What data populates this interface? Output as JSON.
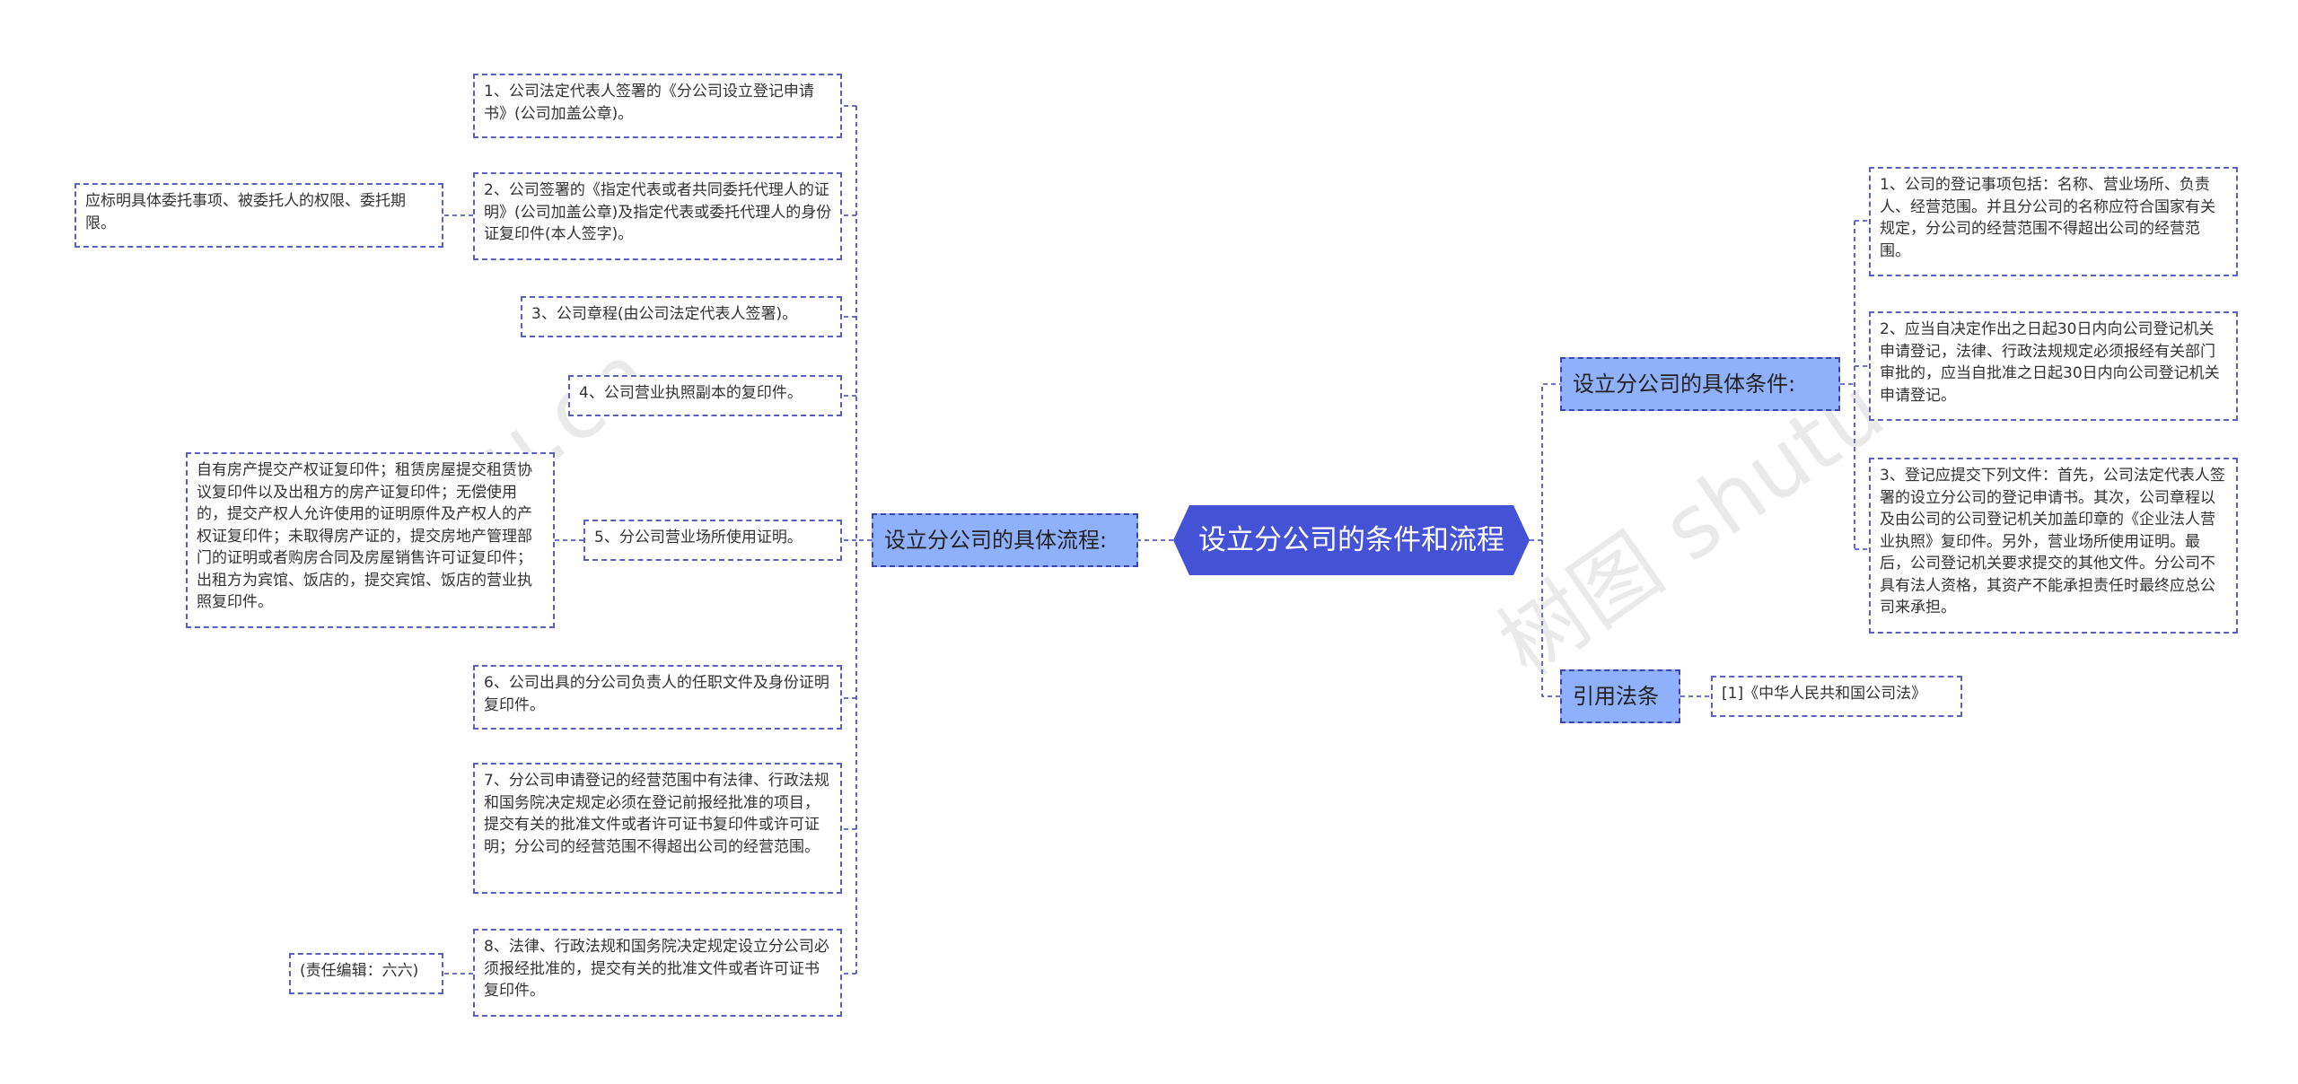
{
  "root": {
    "title": "设立分公司的条件和流程"
  },
  "left_branch": {
    "label": "设立分公司的具体流程:",
    "items": [
      {
        "text": "1、公司法定代表人签署的《分公司设立登记申请书》(公司加盖公章)。"
      },
      {
        "text": "2、公司签署的《指定代表或者共同委托代理人的证明》(公司加盖公章)及指定代表或委托代理人的身份证复印件(本人签字)。",
        "note": "应标明具体委托事项、被委托人的权限、委托期限。"
      },
      {
        "text": "3、公司章程(由公司法定代表人签署)。"
      },
      {
        "text": "4、公司营业执照副本的复印件。"
      },
      {
        "text": "5、分公司营业场所使用证明。",
        "note": "自有房产提交产权证复印件；租赁房屋提交租赁协议复印件以及出租方的房产证复印件；无偿使用的，提交产权人允许使用的证明原件及产权人的产权证复印件；未取得房产证的，提交房地产管理部门的证明或者购房合同及房屋销售许可证复印件；出租方为宾馆、饭店的，提交宾馆、饭店的营业执照复印件。"
      },
      {
        "text": "6、公司出具的分公司负责人的任职文件及身份证明复印件。"
      },
      {
        "text": "7、分公司申请登记的经营范围中有法律、行政法规和国务院决定规定必须在登记前报经批准的项目，提交有关的批准文件或者许可证书复印件或许可证明；分公司的经营范围不得超出公司的经营范围。"
      },
      {
        "text": "8、法律、行政法规和国务院决定规定设立分公司必须报经批准的，提交有关的批准文件或者许可证书复印件。",
        "note": "(责任编辑：六六)"
      }
    ]
  },
  "right_branches": [
    {
      "label": "设立分公司的具体条件:",
      "items": [
        {
          "text": "1、公司的登记事项包括：名称、营业场所、负责人、经营范围。并且分公司的名称应符合国家有关规定，分公司的经营范围不得超出公司的经营范围。"
        },
        {
          "text": "2、应当自决定作出之日起30日内向公司登记机关申请登记，法律、行政法规规定必须报经有关部门审批的，应当自批准之日起30日内向公司登记机关申请登记。"
        },
        {
          "text": "3、登记应提交下列文件：首先，公司法定代表人签署的设立分公司的登记申请书。其次，公司章程以及由公司的公司登记机关加盖印章的《企业法人营业执照》复印件。另外，营业场所使用证明。最后，公司登记机关要求提交的其他文件。分公司不具有法人资格，其资产不能承担责任时最终应总公司来承担。"
        }
      ]
    },
    {
      "label": "引用法条",
      "items": [
        {
          "text": "[1]《中华人民共和国公司法》"
        }
      ]
    }
  ],
  "watermarks": [
    "shutu.cn",
    "树图 shutu.cn"
  ],
  "colors": {
    "root_fill": "#4452d6",
    "branch_fill": "#8fb1fb",
    "connector": "#3d44b8",
    "node_border": "#5a5fc0"
  }
}
